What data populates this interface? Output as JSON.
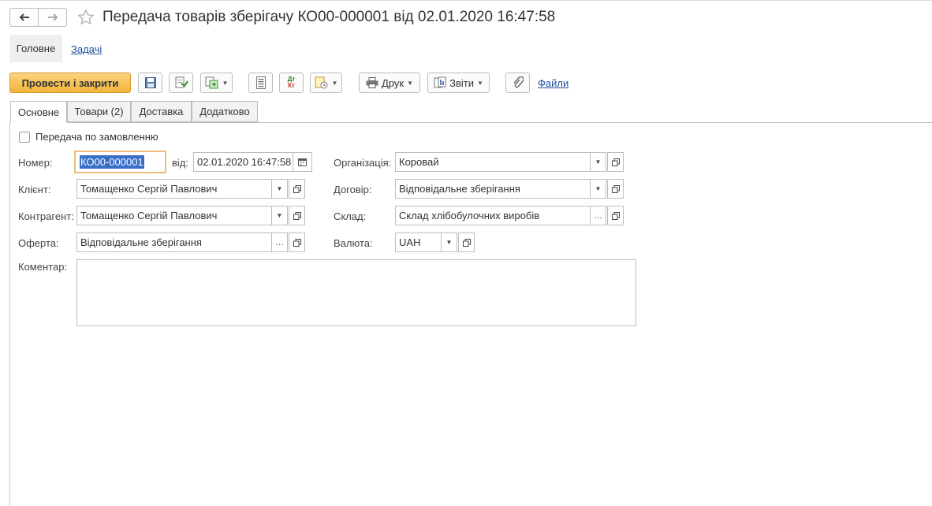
{
  "window": {
    "title": "Передача товарів зберігачу КО00-000001 від 02.01.2020 16:47:58",
    "nav_back": "back-arrow",
    "nav_forward": "forward-arrow",
    "favorite": "star-icon"
  },
  "sections": {
    "main": "Головне",
    "tasks": "Задачі"
  },
  "toolbar": {
    "post_close": "Провести і закрити",
    "print": "Друк",
    "reports": "Звіти",
    "files": "Файли",
    "dt_kt_top": "Дт",
    "dt_kt_bottom": "Кт"
  },
  "tabs": [
    {
      "label": "Основне",
      "active": true
    },
    {
      "label": "Товари (2)",
      "active": false
    },
    {
      "label": "Доставка",
      "active": false
    },
    {
      "label": "Додатково",
      "active": false
    }
  ],
  "form": {
    "by_order_label": "Передача по замовленню",
    "number_label": "Номер:",
    "number_value": "КО00-000001",
    "date_label": "від:",
    "date_value": "02.01.2020 16:47:58",
    "org_label": "Організація:",
    "org_value": "Коровай",
    "client_label": "Клієнт:",
    "client_value": "Томащенко Сергій Павлович",
    "contract_label": "Договір:",
    "contract_value": "Відповідальне зберігання",
    "counterparty_label": "Контрагент:",
    "counterparty_value": "Томащенко Сергій Павлович",
    "warehouse_label": "Склад:",
    "warehouse_value": "Склад хлібобулочних виробів",
    "offer_label": "Оферта:",
    "offer_value": "Відповідальне зберігання",
    "currency_label": "Валюта:",
    "currency_value": "UAH",
    "comment_label": "Коментар:",
    "comment_value": ""
  },
  "colors": {
    "accent": "#f2b43a",
    "link": "#1f4e9c",
    "selection": "#3a6fc8"
  }
}
